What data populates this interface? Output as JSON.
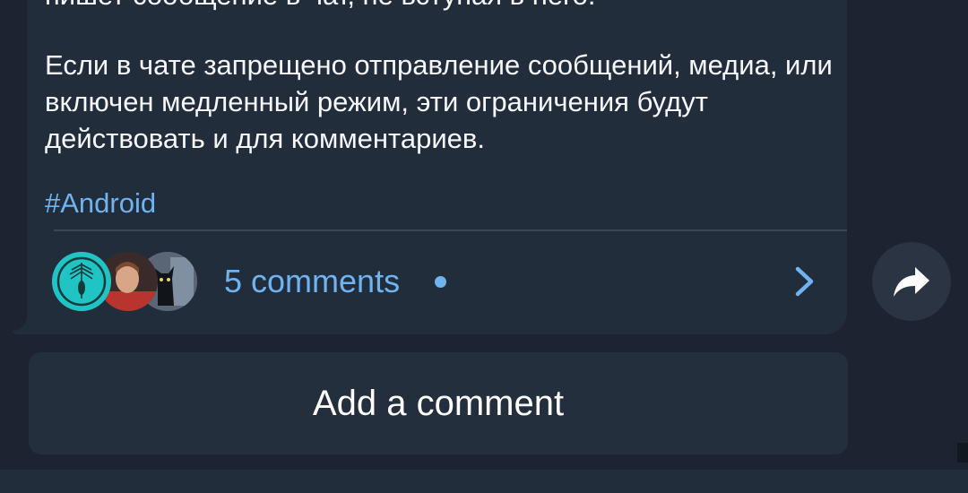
{
  "message": {
    "cut_line": "пишет сообщение в чат, не вступая в него.",
    "paragraph": "Если в чате запрещено отправление сообщений, медиа, или включен медленный режим, эти ограничения будут действовать и для комментариев.",
    "hashtag": "#Android"
  },
  "comments": {
    "label": "5 comments",
    "avatars": [
      "avatar-1",
      "avatar-2",
      "avatar-3"
    ]
  },
  "share": {
    "icon": "share-icon"
  },
  "add_comment": {
    "label": "Add a comment"
  },
  "colors": {
    "background": "#1b2430",
    "bubble": "#222d3b",
    "link": "#6fb3f0",
    "text": "#f5f7fa"
  }
}
